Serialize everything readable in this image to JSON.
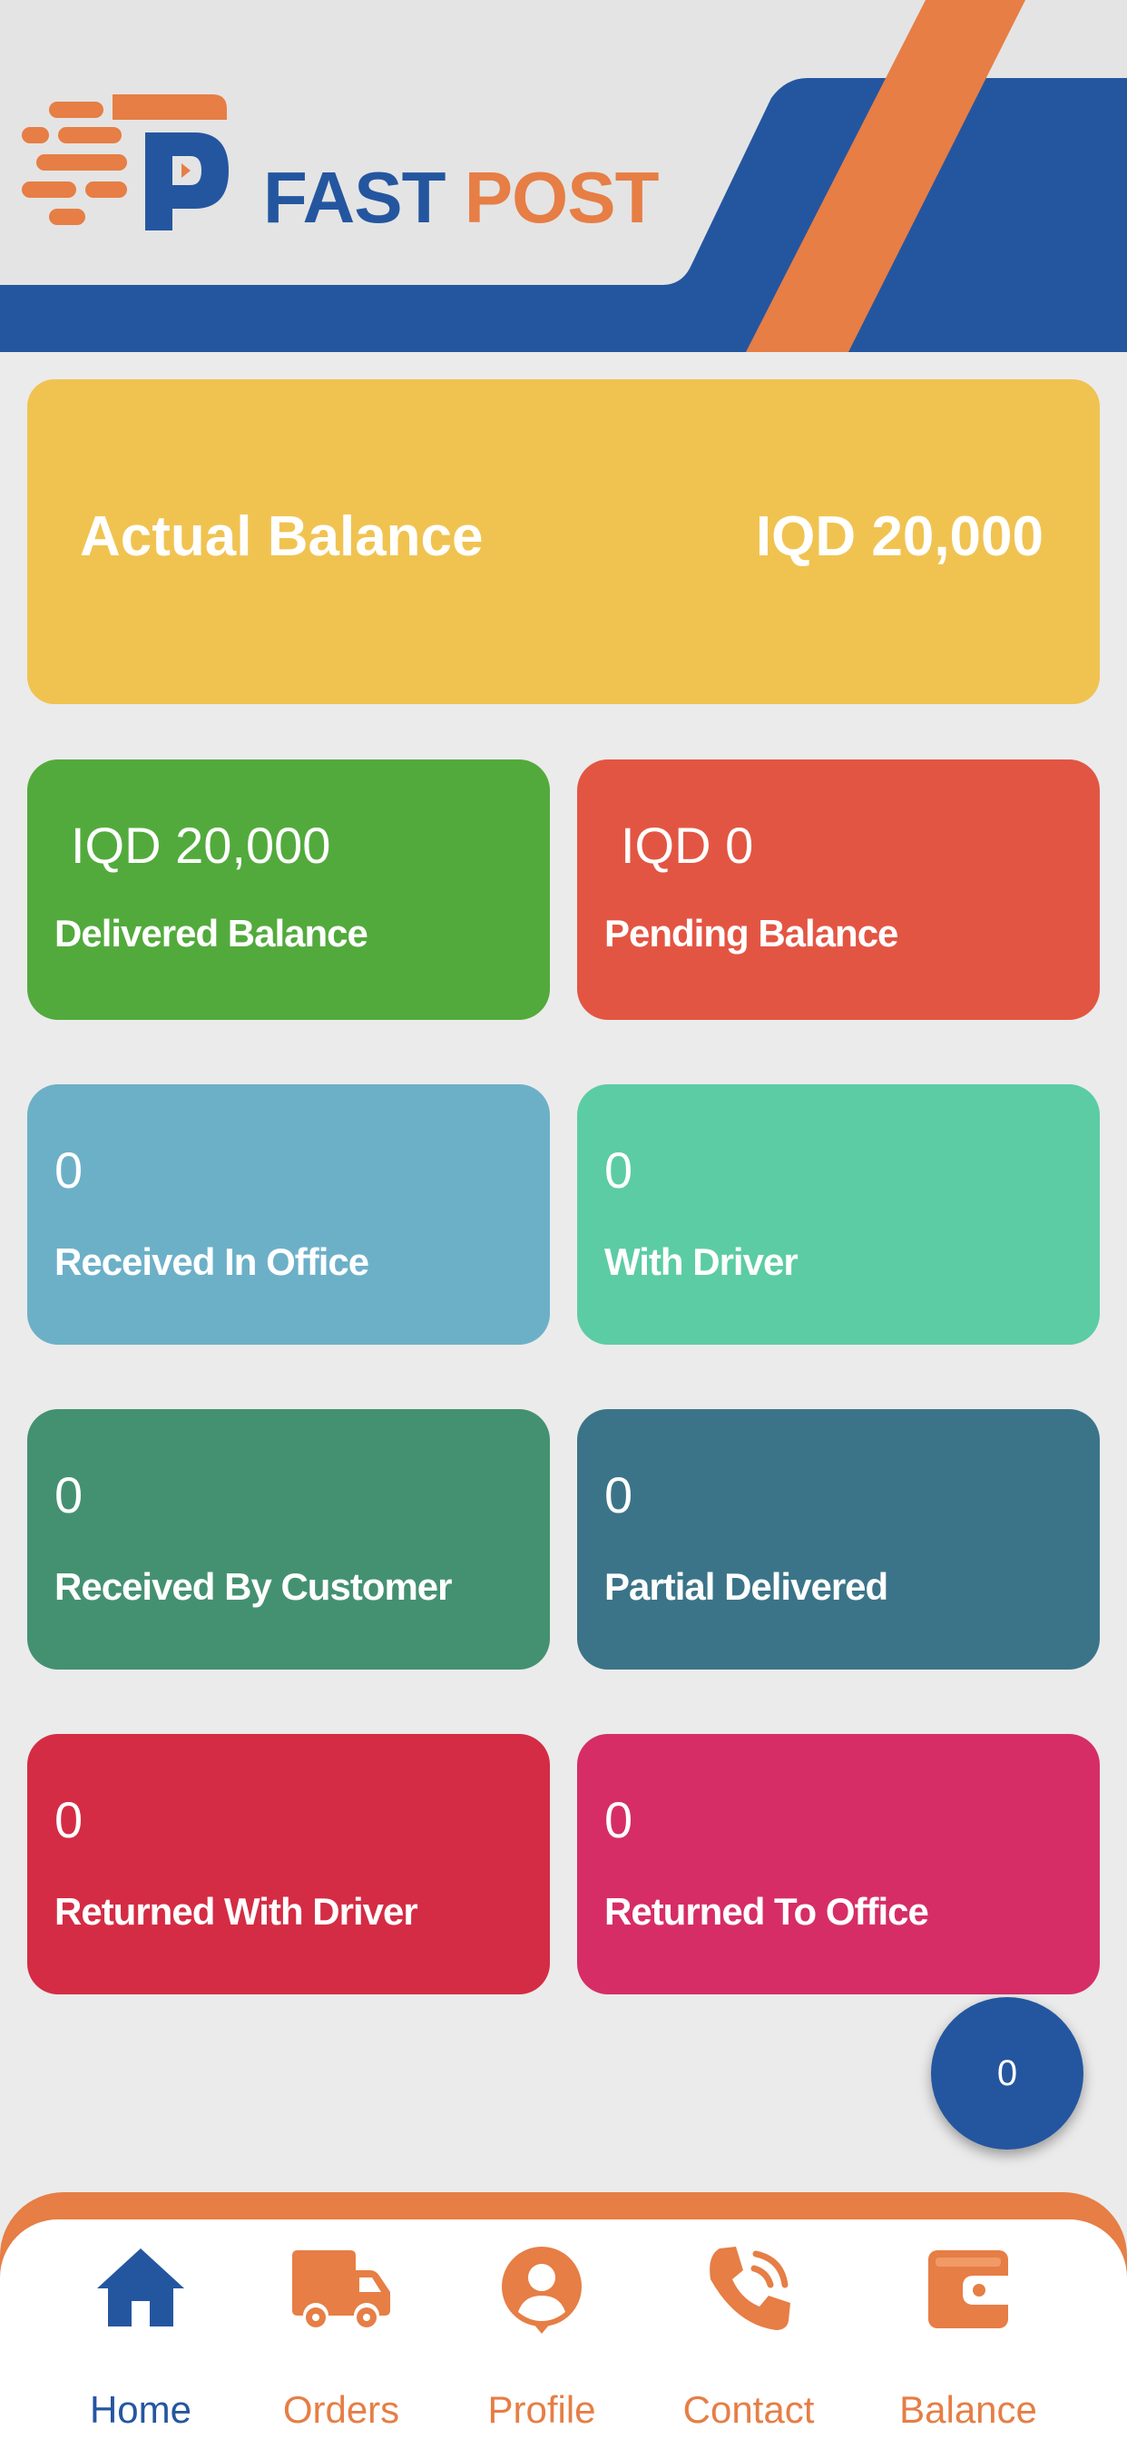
{
  "brand": {
    "fast": "FAST",
    "post": "POST"
  },
  "actual_balance": {
    "label": "Actual Balance",
    "amount": "IQD 20,000"
  },
  "tiles": [
    {
      "value": "IQD 20,000",
      "label": "Delivered Balance",
      "color": "#52aa3c"
    },
    {
      "value": "IQD 0",
      "label": "Pending Balance",
      "color": "#e35543"
    },
    {
      "value": "0",
      "label": "Received In Office",
      "color": "#6cb0c8"
    },
    {
      "value": "0",
      "label": "With Driver",
      "color": "#5ccca5"
    },
    {
      "value": "0",
      "label": "Received By Customer",
      "color": "#449171"
    },
    {
      "value": "0",
      "label": "Partial Delivered",
      "color": "#3b7488"
    },
    {
      "value": "0",
      "label": "Returned With Driver",
      "color": "#d42c44"
    },
    {
      "value": "0",
      "label": "Returned To Office",
      "color": "#d62d67"
    }
  ],
  "fab": {
    "count": "0"
  },
  "nav": [
    {
      "label": "Home",
      "icon": "home-icon",
      "active": true
    },
    {
      "label": "Orders",
      "icon": "truck-icon"
    },
    {
      "label": "Profile",
      "icon": "profile-icon"
    },
    {
      "label": "Contact",
      "icon": "phone-icon"
    },
    {
      "label": "Balance",
      "icon": "wallet-icon"
    }
  ],
  "colors": {
    "primary": "#2456a0",
    "accent": "#e67e45",
    "balance": "#f0c351"
  }
}
